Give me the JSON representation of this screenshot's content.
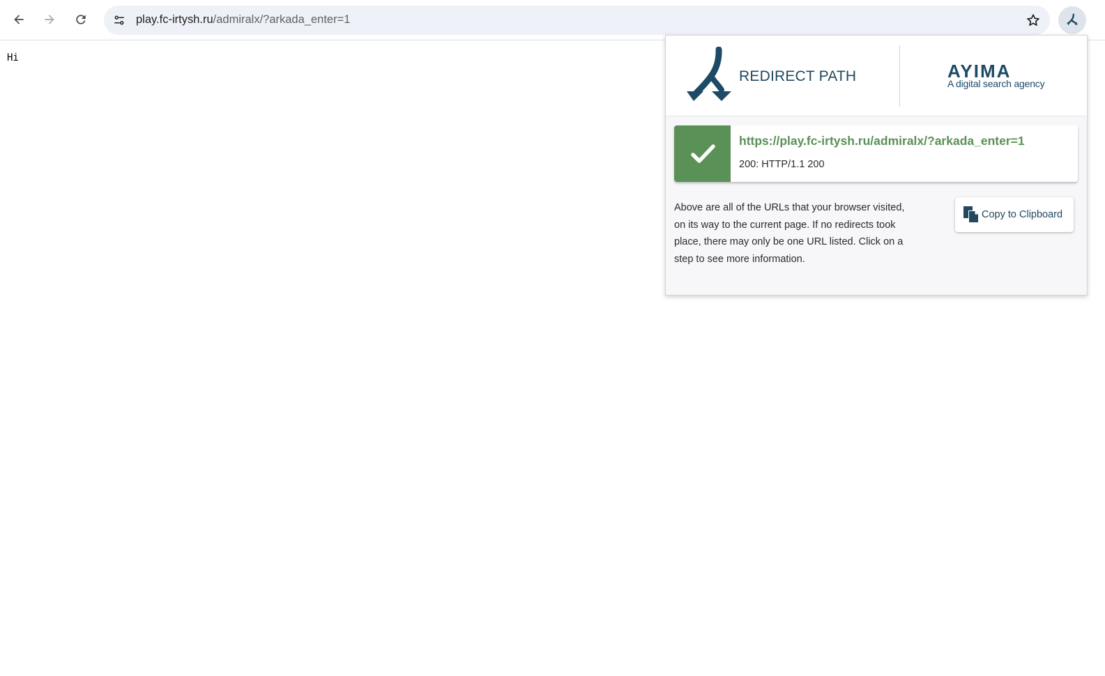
{
  "browser": {
    "url_host": "play.fc-irtysh.ru",
    "url_path": "/admiralx/?arkada_enter=1",
    "icons": {
      "back": "arrow-left-icon",
      "forward": "arrow-right-icon",
      "reload": "reload-icon",
      "site_info": "tune-icon",
      "bookmark": "star-outline-icon",
      "extension": "redirect-path-icon"
    }
  },
  "page": {
    "body_text": "Hi"
  },
  "popup": {
    "brand_title": "REDIRECT PATH",
    "partner_name": "AYIMA",
    "partner_tagline": "A digital search agency",
    "steps": [
      {
        "url": "https://play.fc-irtysh.ru/admiralx/?arkada_enter=1",
        "status": "200: HTTP/1.1 200",
        "status_icon": "checkmark-icon",
        "status_color": "#5a9157"
      }
    ],
    "info_text": "Above are all of the URLs that your browser visited, on its way to the current page. If no redirects took place, there may only be one URL listed. Click on a step to see more information.",
    "copy_button_label": "Copy to Clipboard",
    "copy_icon": "clipboard-icon",
    "colors": {
      "brand": "#21485e",
      "success": "#5a9157"
    }
  }
}
